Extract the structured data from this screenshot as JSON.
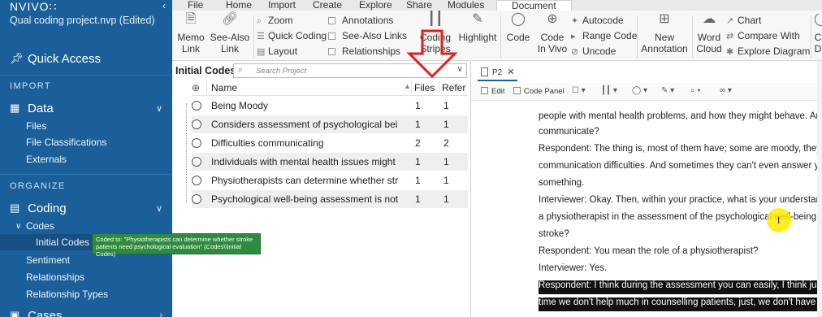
{
  "sidebar": {
    "logo": "NVIVO∷",
    "project_title": "Qual coding project.nvp (Edited)",
    "quick_access": "Quick Access",
    "import_section": "IMPORT",
    "data_group": "Data",
    "data_items": [
      "Files",
      "File Classifications",
      "Externals"
    ],
    "organize_section": "ORGANIZE",
    "coding_group": "Coding",
    "codes_label": "Codes",
    "initial_codes_label": "Initial Codes",
    "coding_items": [
      "Sentiment",
      "Relationships",
      "Relationship Types"
    ],
    "cases_group": "Cases"
  },
  "tooltip": {
    "line1": "Coded to: \"Physiotherapists can determine whether stroke",
    "line2": "patients need psychological evaluation\" (Codes\\\\Initial Codes)"
  },
  "ribbon": {
    "tabs": [
      "File",
      "Home",
      "Import",
      "Create",
      "Explore",
      "Share",
      "Modules",
      "Document"
    ],
    "active_tab": "Document",
    "memo_link": [
      "Memo",
      "Link"
    ],
    "see_also_link": [
      "See-Also",
      "Link"
    ],
    "zoom": "Zoom",
    "quick_coding": "Quick Coding",
    "layout": "Layout",
    "annotations": "Annotations",
    "see_also_links": "See-Also Links",
    "relationships": "Relationships",
    "coding_stripes": [
      "Coding",
      "Stripes"
    ],
    "highlight": "Highlight",
    "code": "Code",
    "code_in_vivo": [
      "Code",
      "In Vivo"
    ],
    "autocode": "Autocode",
    "range_code": "Range Code",
    "uncode": "Uncode",
    "new_annotation": [
      "New",
      "Annotation"
    ],
    "word_cloud": [
      "Word",
      "Cloud"
    ],
    "chart": "Chart",
    "compare_with": "Compare With",
    "explore_diagram": "Explore Diagram",
    "trailing": [
      "C",
      "D"
    ]
  },
  "list": {
    "title": "Initial Codes",
    "search_placeholder": "Search Project",
    "columns": {
      "name": "Name",
      "files": "Files",
      "refs": "Refer"
    },
    "rows": [
      {
        "name": "Being Moody",
        "files": "1",
        "refs": "1"
      },
      {
        "name": "Considers assessment of psychological being a",
        "files": "1",
        "refs": "1"
      },
      {
        "name": "Difficulties communicating",
        "files": "2",
        "refs": "2"
      },
      {
        "name": "Individuals with mental health issues might fig",
        "files": "1",
        "refs": "1"
      },
      {
        "name": "Physiotherapists can determine whether stroke",
        "files": "1",
        "refs": "1"
      },
      {
        "name": "Psychological well-being assessment is not cur",
        "files": "1",
        "refs": "1"
      }
    ]
  },
  "document": {
    "tab_label": "P2",
    "edit_label": "Edit",
    "code_panel_label": "Code Panel",
    "lines": [
      "people with mental health problems, and how they might behave. And how might t",
      "communicate?",
      "Respondent: The thing is, most of them have; some are moody, they have got",
      "communication difficulties. And sometimes they can't even answer you when you a",
      "something.",
      "Interviewer: Okay. Then, within your practice, what is your understanding of the rol",
      "a physiotherapist in the assessment of the psychological well-being of patients with",
      "stroke?",
      "Respondent: You mean the role of a physiotherapist?",
      "Interviewer: Yes.",
      "Respondent: I think during the assessment you can easily, I think just to identify, mo",
      "time we don't help much in counselling patients, just, we don't have that knowledge"
    ]
  },
  "colors": {
    "sidebar": "#1b5f9a",
    "tooltip": "#2e8b3e",
    "annotation_arrow": "#e02020",
    "cursor_highlight": "#ffeb00"
  }
}
